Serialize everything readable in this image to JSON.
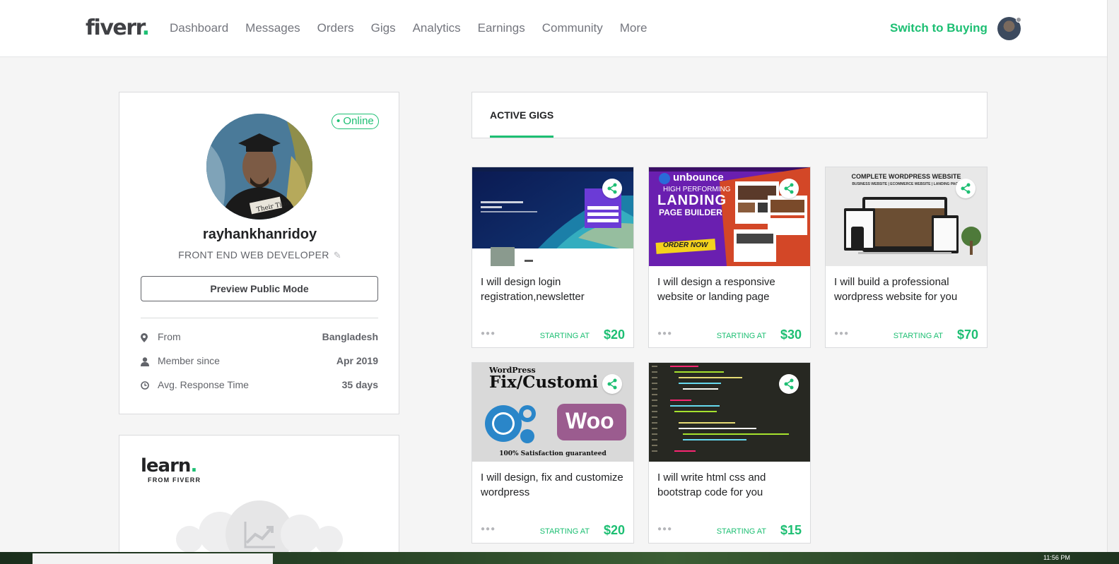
{
  "header": {
    "logo": "fiverr",
    "logo_dot": ".",
    "nav": [
      "Dashboard",
      "Messages",
      "Orders",
      "Gigs",
      "Analytics",
      "Earnings",
      "Community",
      "More"
    ],
    "switch_label": "Switch to Buying"
  },
  "profile": {
    "status": "• Online",
    "username": "rayhankhanridoy",
    "title": "FRONT END WEB DEVELOPER",
    "preview_label": "Preview Public Mode",
    "stats": [
      {
        "icon": "location-pin-icon",
        "label": "From",
        "value": "Bangladesh"
      },
      {
        "icon": "user-icon",
        "label": "Member since",
        "value": "Apr 2019"
      },
      {
        "icon": "clock-icon",
        "label": "Avg. Response Time",
        "value": "35 days"
      }
    ]
  },
  "learn": {
    "logo": "learn",
    "logo_dot": ".",
    "subtitle": "FROM FIVERR"
  },
  "gigs": {
    "tab_label": "ACTIVE GIGS",
    "starting_label": "STARTING AT",
    "items": [
      {
        "title": "I will design login registration,newsletter",
        "price": "$20"
      },
      {
        "title": "I will design a responsive website or landing page",
        "price": "$30"
      },
      {
        "title": "I will build a professional wordpress website for you",
        "price": "$70"
      },
      {
        "title": "I will design, fix and customize wordpress",
        "price": "$20"
      },
      {
        "title": "I will write html css and bootstrap code for you",
        "price": "$15"
      }
    ],
    "image_text": {
      "unbounce": "unbounce",
      "high_performing": "HIGH PERFORMING",
      "landing": "LANDING",
      "page_builder": "PAGE BUILDER",
      "order_now": "ORDER NOW",
      "complete_wp": "COMPLETE WORDPRESS WEBSITE",
      "wp_sub": "BUSINESS WEBSITE | ECOMMERCE WEBSITE | LANDING PAGE",
      "wordpress": "WordPress",
      "fix_customize": "Fix/Customi",
      "woo": "Woo",
      "satisfaction": "100% Satisfaction guaranteed"
    }
  },
  "colors": {
    "brand": "#1dbf73",
    "text": "#404145"
  },
  "taskbar": {
    "clock": "11:56 PM"
  }
}
